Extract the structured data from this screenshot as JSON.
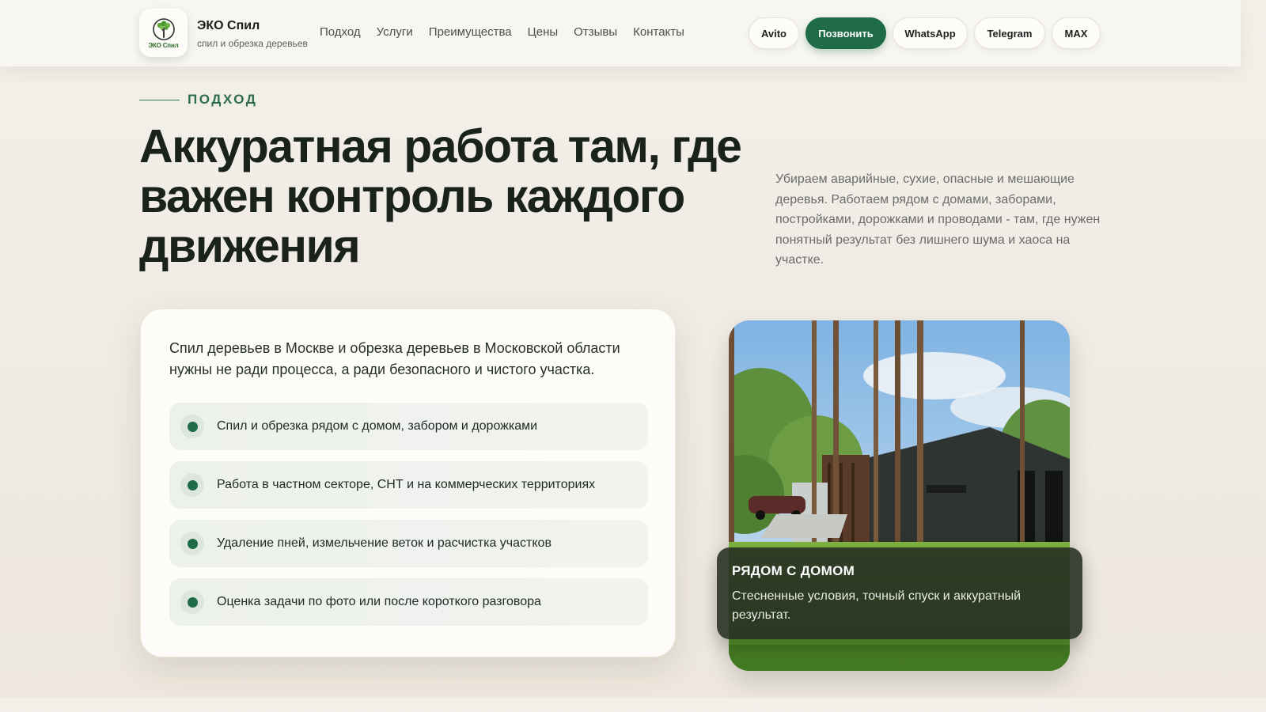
{
  "brand": {
    "logo_text": "ЭКО Спил",
    "name": "ЭКО Спил",
    "tagline": "спил и обрезка деревьев"
  },
  "nav": {
    "items": [
      {
        "label": "Подход"
      },
      {
        "label": "Услуги"
      },
      {
        "label": "Преимущества"
      },
      {
        "label": "Цены"
      },
      {
        "label": "Отзывы"
      },
      {
        "label": "Контакты"
      }
    ]
  },
  "actions": {
    "avito": "Avito",
    "call": "Позвонить",
    "whatsapp": "WhatsApp",
    "telegram": "Telegram",
    "max": "MAX"
  },
  "section": {
    "eyebrow": "ПОДХОД",
    "title": "Аккуратная работа там, где важен контроль каждого движения",
    "lead": "Убираем аварийные, сухие, опасные и мешающие деревья. Работаем рядом с домами, заборами, постройками, дорожками и проводами - там, где нужен понятный результат без лишнего шума и хаоса на участке."
  },
  "card": {
    "intro": "Спил деревьев в Москве и обрезка деревьев в Московской области нужны не ради процесса, а ради безопасного и чистого участка.",
    "features": [
      "Спил и обрезка рядом с домом, забором и дорожками",
      "Работа в частном секторе, СНТ и на коммерческих территориях",
      "Удаление пней, измельчение веток и расчистка участков",
      "Оценка задачи по фото или после короткого разговора"
    ]
  },
  "photo": {
    "overlay_title": "РЯДОМ С ДОМОМ",
    "overlay_text": "Стесненные условия, точный спуск и аккуратный результат."
  },
  "colors": {
    "accent": "#1f6a47",
    "background": "#f1ede6",
    "card": "#fdfcf9",
    "heading": "#1a221c"
  },
  "icons": {
    "logo": "tree-logo-icon",
    "feature_bullet": "dot-icon"
  }
}
